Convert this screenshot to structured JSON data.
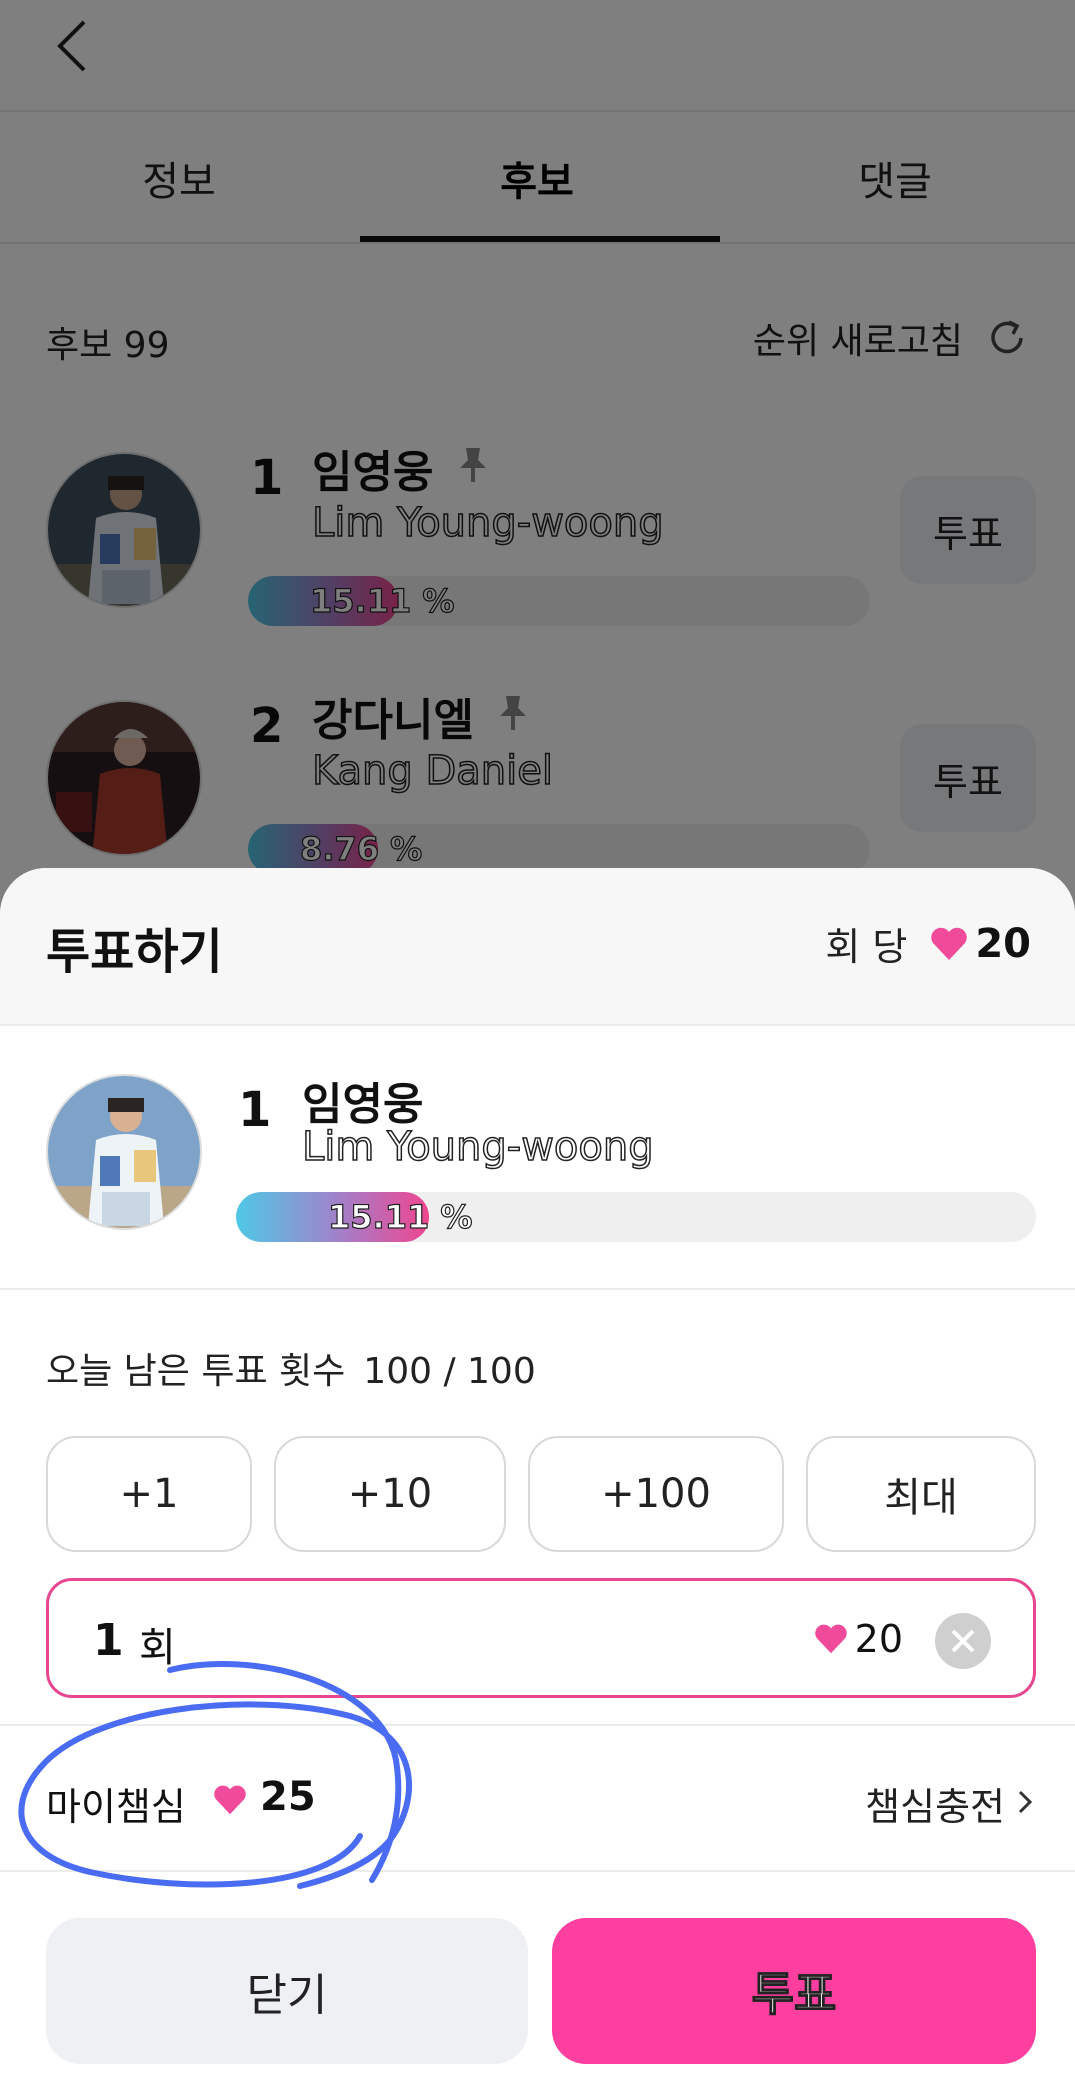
{
  "header": {
    "back_label": "back"
  },
  "tabs": [
    {
      "label": "정보",
      "active": false
    },
    {
      "label": "후보",
      "active": true
    },
    {
      "label": "댓글",
      "active": false
    }
  ],
  "candidates_header": {
    "count_label": "후보 99",
    "refresh_label": "순위 새로고침"
  },
  "candidates": [
    {
      "rank": "1",
      "name_ko": "임영웅",
      "name_en": "Lim Young-woong",
      "percent_label": "15.11 %",
      "percent": 15.11,
      "vote_label": "투표"
    },
    {
      "rank": "2",
      "name_ko": "강다니엘",
      "name_en": "Kang Daniel",
      "percent_label": "8.76 %",
      "percent": 8.76,
      "vote_label": "투표"
    }
  ],
  "sheet": {
    "title": "투표하기",
    "per_label": "회 당",
    "per_cost": "20",
    "selected": {
      "rank": "1",
      "name_ko": "임영웅",
      "name_en": "Lim Young-woong",
      "percent_label": "15.11 %",
      "percent": 15.11
    },
    "remain_label": "오늘 남은 투표 횟수",
    "remain_value": "100 / 100",
    "chips": [
      "+1",
      "+10",
      "+100",
      "최대"
    ],
    "quantity": {
      "count": "1",
      "unit": "회",
      "hearts": "20"
    },
    "my_label": "마이챔심",
    "my_value": "25",
    "charge_label": "챔심충전",
    "close_label": "닫기",
    "submit_label": "투표"
  },
  "colors": {
    "accent": "#ff3fa0",
    "heart": "#f04a9a",
    "annotation": "#4a6cf2"
  }
}
